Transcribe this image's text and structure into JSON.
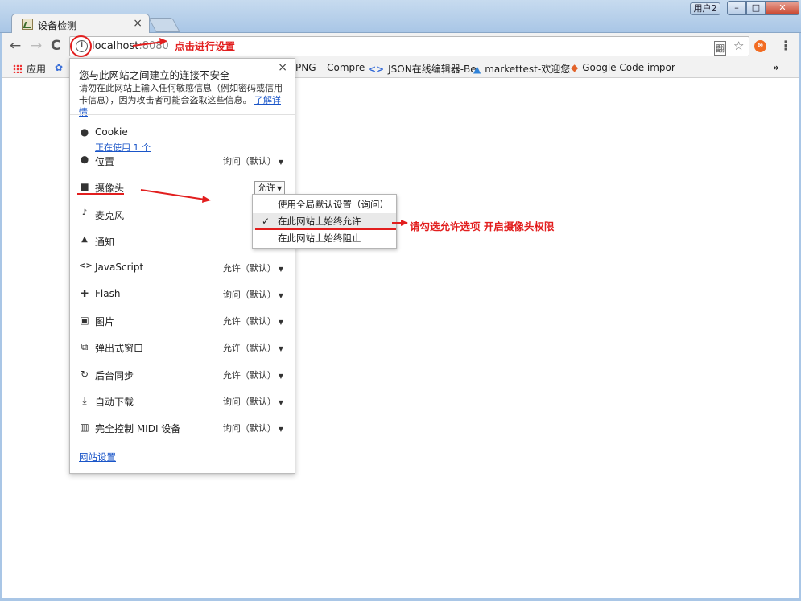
{
  "tab": {
    "title": "设备检测",
    "close": "×"
  },
  "window": {
    "user_badge": "用户2",
    "min": "–",
    "max": "□",
    "close": "✕"
  },
  "toolbar": {
    "back": "←",
    "forward": "→",
    "reload": "C",
    "url_host": "localhost",
    "url_port": ":8080",
    "translate_icon": "翻",
    "star": "☆",
    "extension_label": "⊗",
    "menu": "⋮"
  },
  "bookmarks": [
    {
      "icon": "apps-icon",
      "label": "应用"
    },
    {
      "icon": "paw-icon",
      "label": ""
    },
    {
      "icon": "",
      "label": "PNG – Compre"
    },
    {
      "icon": "code-icon",
      "label": "JSON在线编辑器-Be"
    },
    {
      "icon": "azure-icon",
      "label": "markettest-欢迎您"
    },
    {
      "icon": "gitlab-icon",
      "label": "Google Code impor"
    }
  ],
  "bookmarks_more": "»",
  "popup": {
    "title": "您与此网站之间建立的连接不安全",
    "body": "请勿在此网站上输入任何敏感信息（例如密码或信用卡信息），因为攻击者可能会盗取这些信息。",
    "learn_more": "了解详情",
    "close": "×",
    "cookie_label": "Cookie",
    "cookie_sub": "正在使用 1 个",
    "permissions": [
      {
        "icon": "location-icon",
        "glyph": "⬤",
        "label": "位置",
        "value": "询问（默认）"
      },
      {
        "icon": "camera-icon",
        "glyph": "■",
        "label": "摄像头",
        "value": "允许"
      },
      {
        "icon": "mic-icon",
        "glyph": "🎙",
        "label": "麦克风",
        "value": ""
      },
      {
        "icon": "bell-icon",
        "glyph": "🔔",
        "label": "通知",
        "value": ""
      },
      {
        "icon": "code-icon",
        "glyph": "<>",
        "label": "JavaScript",
        "value": "允许（默认）"
      },
      {
        "icon": "puzzle-icon",
        "glyph": "✚",
        "label": "Flash",
        "value": "询问（默认）"
      },
      {
        "icon": "image-icon",
        "glyph": "▣",
        "label": "图片",
        "value": "允许（默认）"
      },
      {
        "icon": "popup-icon",
        "glyph": "⧉",
        "label": "弹出式窗口",
        "value": "允许（默认）"
      },
      {
        "icon": "sync-icon",
        "glyph": "↻",
        "label": "后台同步",
        "value": "允许（默认）"
      },
      {
        "icon": "download-icon",
        "glyph": "⤓",
        "label": "自动下载",
        "value": "询问（默认）"
      },
      {
        "icon": "midi-icon",
        "glyph": "▥",
        "label": "完全控制 MIDI 设备",
        "value": "询问（默认）"
      }
    ],
    "site_settings": "网站设置"
  },
  "dropdown": {
    "options": [
      {
        "label": "使用全局默认设置（询问）",
        "selected": false
      },
      {
        "label": "在此网站上始终允许",
        "selected": true
      },
      {
        "label": "在此网站上始终阻止",
        "selected": false
      }
    ],
    "check": "✓"
  },
  "annotations": {
    "click_setting": "点击进行设置",
    "allow_camera": "请勾选允许选项 开启摄像头权限"
  },
  "colors": {
    "annotation_red": "#e21e1e",
    "link_blue": "#1a55c8",
    "frame_blue": "#a9c6e6"
  }
}
